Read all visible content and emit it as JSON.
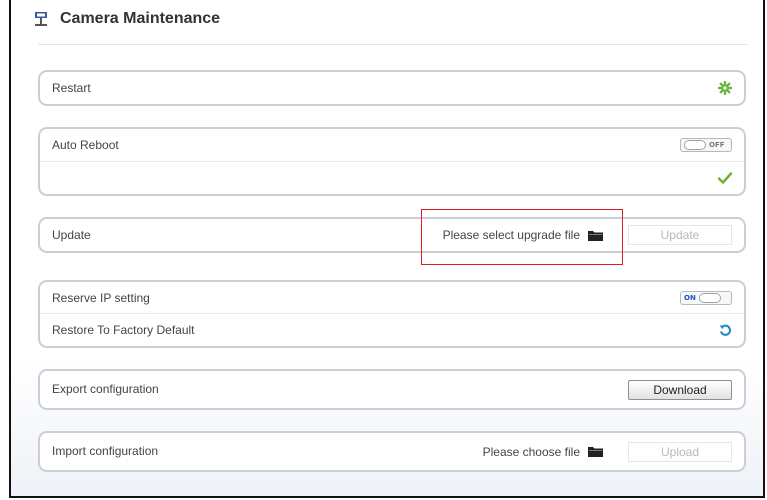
{
  "page": {
    "title": "Camera Maintenance"
  },
  "restart": {
    "label": "Restart",
    "icon": "gear-icon"
  },
  "auto_reboot": {
    "label": "Auto Reboot",
    "toggle_state": "OFF",
    "confirm_icon": "checkmark-icon"
  },
  "update": {
    "label": "Update",
    "file_prompt": "Please select upgrade file",
    "button": "Update"
  },
  "reserve_ip": {
    "label": "Reserve IP setting",
    "toggle_state": "ON"
  },
  "factory_default": {
    "label": "Restore To Factory Default",
    "icon": "restore-icon"
  },
  "export_cfg": {
    "label": "Export configuration",
    "button": "Download"
  },
  "import_cfg": {
    "label": "Import configuration",
    "file_prompt": "Please choose file",
    "button": "Upload"
  },
  "colors": {
    "accent_green": "#6db33f",
    "accent_blue": "#1f86c8",
    "highlight": "#e21c21"
  }
}
